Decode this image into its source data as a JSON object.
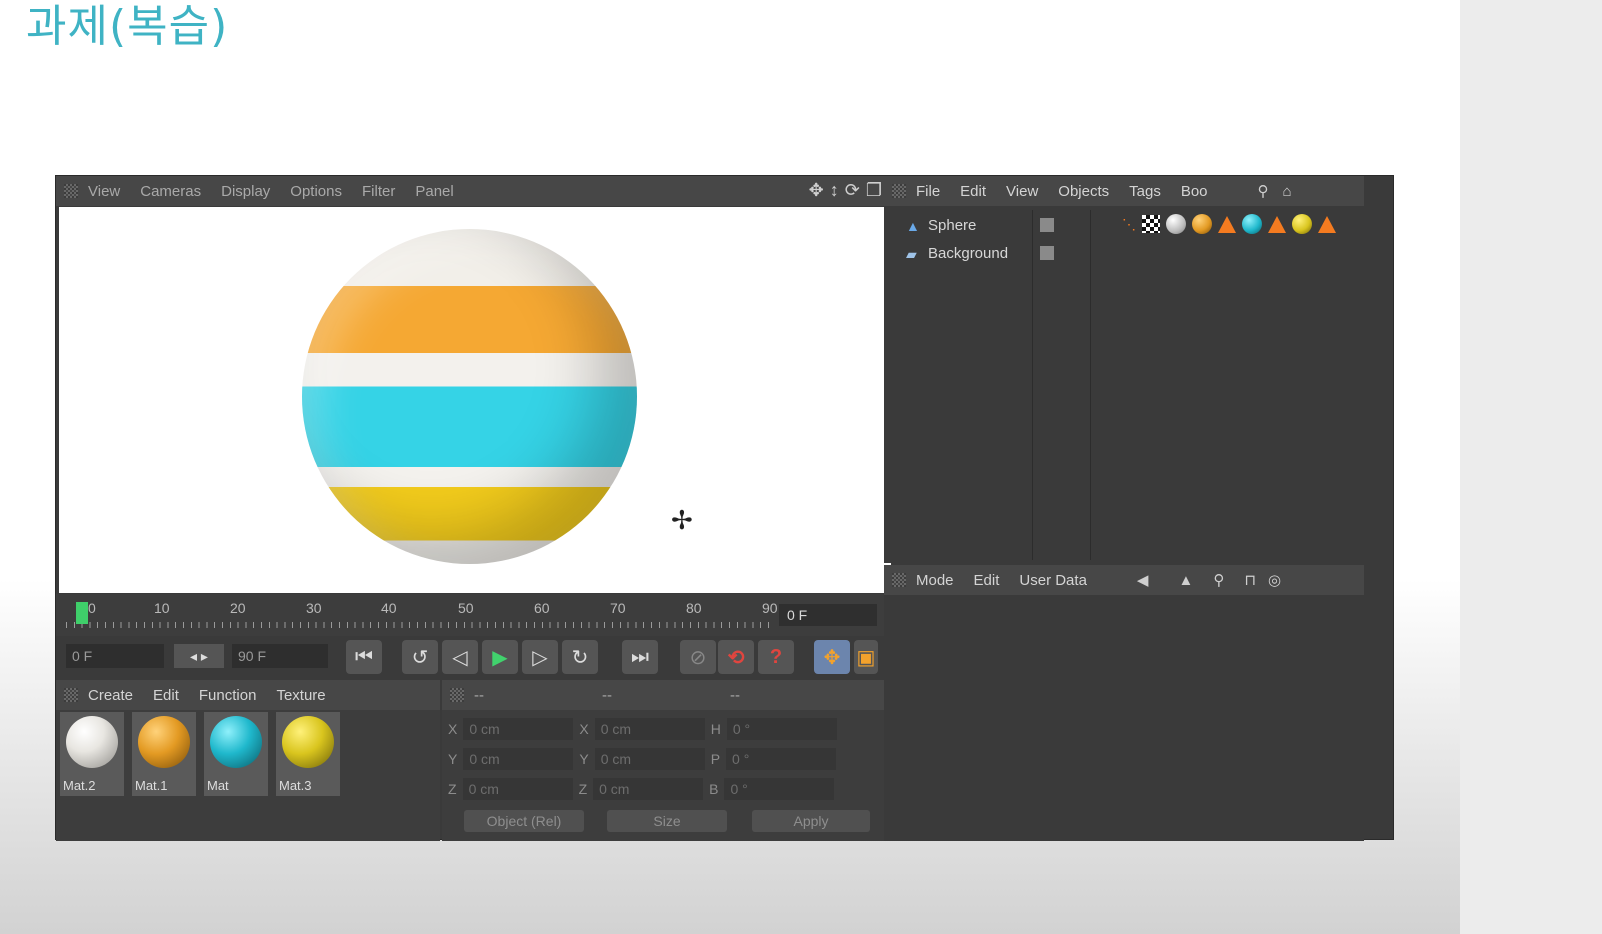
{
  "slide": {
    "title": "과제(복습)"
  },
  "viewport": {
    "menu": [
      "View",
      "Cameras",
      "Display",
      "Options",
      "Filter",
      "Panel"
    ],
    "tool_icons": [
      "move-view-icon",
      "zoom-view-icon",
      "rotate-view-icon",
      "maximize-view-icon"
    ]
  },
  "timeline": {
    "ticks": [
      "0",
      "10",
      "20",
      "30",
      "40",
      "50",
      "60",
      "70",
      "80",
      "90"
    ],
    "current_frame": "0 F"
  },
  "transport": {
    "start_frame": "0 F",
    "end_frame": "90 F",
    "colors": {
      "play": "#41d26d",
      "record": "#e0453f",
      "move_tool": "#f3a22c"
    }
  },
  "materials": {
    "menu": [
      "Create",
      "Edit",
      "Function",
      "Texture"
    ],
    "items": [
      {
        "label": "Mat.2",
        "color": "#e8e6e1"
      },
      {
        "label": "Mat.1",
        "color": "#e39a23"
      },
      {
        "label": "Mat",
        "color": "#1fb8cc"
      },
      {
        "label": "Mat.3",
        "color": "#d9c51e"
      }
    ]
  },
  "coordinates": {
    "header": [
      "--",
      "--",
      "--"
    ],
    "rows": [
      {
        "a": "X",
        "av": "0 cm",
        "b": "X",
        "bv": "0 cm",
        "c": "H",
        "cv": "0 °"
      },
      {
        "a": "Y",
        "av": "0 cm",
        "b": "Y",
        "bv": "0 cm",
        "c": "P",
        "cv": "0 °"
      },
      {
        "a": "Z",
        "av": "0 cm",
        "b": "Z",
        "bv": "0 cm",
        "c": "B",
        "cv": "0 °"
      }
    ],
    "mode_select": "Object (Rel)",
    "size_select": "Size",
    "apply_label": "Apply"
  },
  "objects": {
    "menu": [
      "File",
      "Edit",
      "View",
      "Objects",
      "Tags",
      "Boo"
    ],
    "items": [
      "Sphere",
      "Background"
    ]
  },
  "attributes": {
    "menu": [
      "Mode",
      "Edit",
      "User Data"
    ]
  }
}
